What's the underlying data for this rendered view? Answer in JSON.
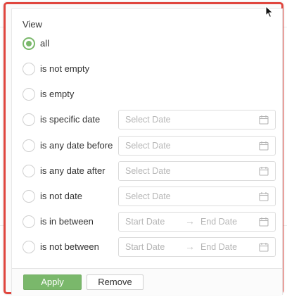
{
  "filter": {
    "view_label": "View",
    "options": [
      {
        "label": "all",
        "selected": true
      },
      {
        "label": "is not empty",
        "selected": false
      },
      {
        "label": "is empty",
        "selected": false
      },
      {
        "label": "is specific date",
        "selected": false,
        "input": {
          "type": "single",
          "placeholder": "Select Date"
        }
      },
      {
        "label": "is any date before",
        "selected": false,
        "input": {
          "type": "single",
          "placeholder": "Select Date"
        }
      },
      {
        "label": "is any date after",
        "selected": false,
        "input": {
          "type": "single",
          "placeholder": "Select Date"
        }
      },
      {
        "label": "is not date",
        "selected": false,
        "input": {
          "type": "single",
          "placeholder": "Select Date"
        }
      },
      {
        "label": "is in between",
        "selected": false,
        "input": {
          "type": "range",
          "start_placeholder": "Start Date",
          "separator": "→",
          "end_placeholder": "End Date"
        }
      },
      {
        "label": "is not between",
        "selected": false,
        "input": {
          "type": "range",
          "start_placeholder": "Start Date",
          "separator": "→",
          "end_placeholder": "End Date"
        }
      }
    ]
  },
  "footer": {
    "apply_label": "Apply",
    "remove_label": "Remove"
  },
  "icons": {
    "calendar": "calendar-icon",
    "cursor": "mouse-cursor-icon"
  },
  "colors": {
    "accent": "#7ab86b",
    "highlight_border": "#e0463e",
    "placeholder": "#b6b6b6"
  }
}
